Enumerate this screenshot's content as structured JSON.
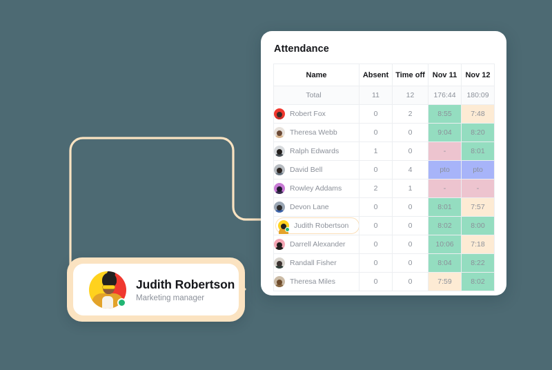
{
  "background_color": "#4d6a73",
  "attendance": {
    "title": "Attendance",
    "columns": [
      "Name",
      "Absent",
      "Time off",
      "Nov 11",
      "Nov 12"
    ],
    "total_row": {
      "label": "Total",
      "absent": "11",
      "time_off": "12",
      "nov11": "176:44",
      "nov12": "180:09"
    },
    "rows": [
      {
        "name": "Robert Fox",
        "absent": "0",
        "time_off": "2",
        "nov11": "8:55",
        "nov11_state": "green",
        "nov12": "7:48",
        "nov12_state": "peach",
        "highlighted": false,
        "avatar_bg": "#f0382f",
        "avatar_hair": "#3a2b26",
        "avatar_body": "#c9312b"
      },
      {
        "name": "Theresa Webb",
        "absent": "0",
        "time_off": "0",
        "nov11": "9:04",
        "nov11_state": "green",
        "nov12": "8:20",
        "nov12_state": "green",
        "highlighted": false,
        "avatar_bg": "#e8e2dc",
        "avatar_hair": "#6b4a36",
        "avatar_body": "#d9b892"
      },
      {
        "name": "Ralph Edwards",
        "absent": "1",
        "time_off": "0",
        "nov11": "-",
        "nov11_state": "pink",
        "nov12": "8:01",
        "nov12_state": "green",
        "highlighted": false,
        "avatar_bg": "#d7dadd",
        "avatar_hair": "#23201e",
        "avatar_body": "#4a5157"
      },
      {
        "name": "David Bell",
        "absent": "0",
        "time_off": "4",
        "nov11": "pto",
        "nov11_state": "blue",
        "nov12": "pto",
        "nov12_state": "blue",
        "highlighted": false,
        "avatar_bg": "#b7bcc1",
        "avatar_hair": "#2a2320",
        "avatar_body": "#6d7a86"
      },
      {
        "name": "Rowley Addams",
        "absent": "2",
        "time_off": "1",
        "nov11": "-",
        "nov11_state": "pink",
        "nov12": "-",
        "nov12_state": "pink",
        "highlighted": false,
        "avatar_bg": "#c77ad4",
        "avatar_hair": "#1d1a2b",
        "avatar_body": "#3a2f52"
      },
      {
        "name": "Devon Lane",
        "absent": "0",
        "time_off": "0",
        "nov11": "8:01",
        "nov11_state": "green",
        "nov12": "7:57",
        "nov12_state": "peach",
        "highlighted": false,
        "avatar_bg": "#9aa6b4",
        "avatar_hair": "#2c2b2a",
        "avatar_body": "#3d62a8"
      },
      {
        "name": "Judith Robertson",
        "absent": "0",
        "time_off": "0",
        "nov11": "8:02",
        "nov11_state": "green",
        "nov12": "8:00",
        "nov12_state": "green",
        "highlighted": true,
        "avatar_bg": "#ffd21e",
        "avatar_hair": "#22201f",
        "avatar_body": "#e3a32a"
      },
      {
        "name": "Darrell Alexander",
        "absent": "0",
        "time_off": "0",
        "nov11": "10:06",
        "nov11_state": "green",
        "nov12": "7:18",
        "nov12_state": "peach",
        "highlighted": false,
        "avatar_bg": "#f4a6b4",
        "avatar_hair": "#201d1c",
        "avatar_body": "#241f1d"
      },
      {
        "name": "Randall Fisher",
        "absent": "0",
        "time_off": "0",
        "nov11": "8:04",
        "nov11_state": "green",
        "nov12": "8:22",
        "nov12_state": "green",
        "highlighted": false,
        "avatar_bg": "#d8d4cd",
        "avatar_hair": "#3b3230",
        "avatar_body": "#31403a"
      },
      {
        "name": "Theresa Miles",
        "absent": "0",
        "time_off": "0",
        "nov11": "7:59",
        "nov11_state": "peach",
        "nov12": "8:02",
        "nov12_state": "green",
        "highlighted": false,
        "avatar_bg": "#cbbba6",
        "avatar_hair": "#6d4b2c",
        "avatar_body": "#8a6a45"
      }
    ]
  },
  "profile": {
    "name": "Judith Robertson",
    "role": "Marketing manager",
    "status": "online"
  },
  "colors": {
    "green": "#94ddc0",
    "peach": "#fdebd4",
    "pink": "#edc4cf",
    "blue": "#a7b4f9",
    "connector": "#fbe3c1",
    "status_online": "#21b573"
  }
}
